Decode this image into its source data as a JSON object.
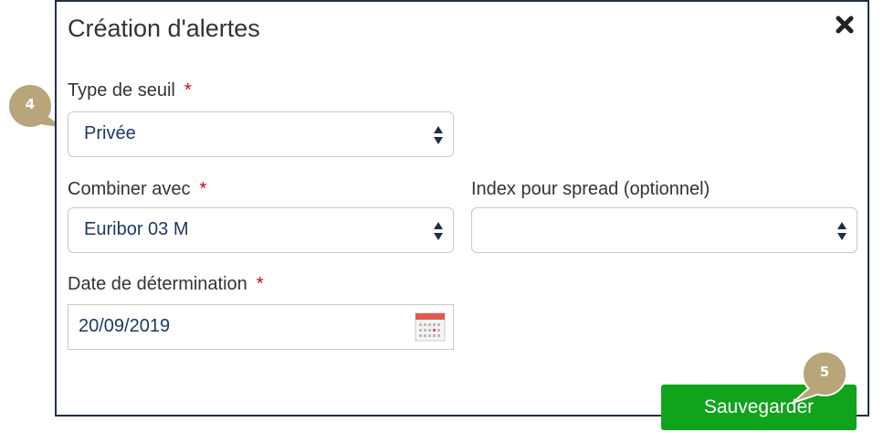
{
  "dialog": {
    "title": "Création d'alertes",
    "close_icon": "close-x-icon"
  },
  "fields": {
    "type_seuil": {
      "label": "Type de seuil",
      "required_mark": "*",
      "value": "Privée"
    },
    "combiner": {
      "label": "Combiner avec",
      "required_mark": "*",
      "value": "Euribor 03 M"
    },
    "index_spread": {
      "label": "Index pour spread (optionnel)",
      "value": ""
    },
    "date_determination": {
      "label": "Date de détermination",
      "required_mark": "*",
      "value": "20/09/2019",
      "icon": "calendar-icon"
    }
  },
  "actions": {
    "save_label": "Sauvegarder"
  },
  "callouts": {
    "step4": "4",
    "step5": "5"
  },
  "colors": {
    "dialog_border": "#1f2d4d",
    "required": "#d0021b",
    "value_text": "#1f3864",
    "save_button": "#10a31c",
    "callout_fill": "#b8a57a"
  }
}
